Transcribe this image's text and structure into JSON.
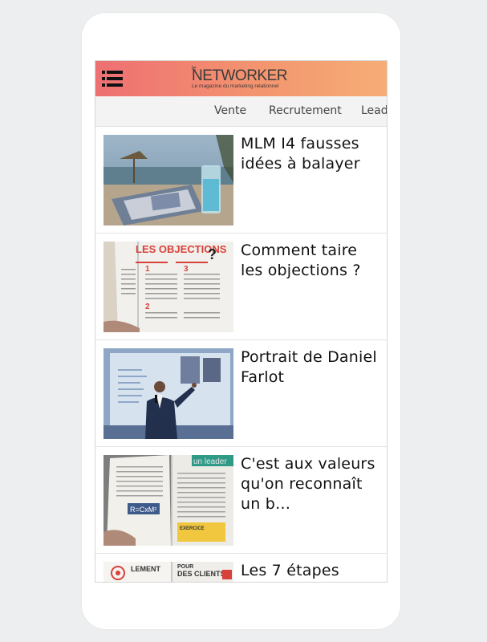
{
  "header": {
    "logo_small": "le",
    "logo_word": "NETWORKER",
    "logo_tagline": "Le magazine du marketing relationnel"
  },
  "categories": [
    "Vente",
    "Recrutement",
    "Lead"
  ],
  "articles": [
    {
      "title": "MLM I4 fausses idées à balayer",
      "image": "beach-magazines"
    },
    {
      "title": "Comment taire les objections ?",
      "image": "magazine-objections"
    },
    {
      "title": "Portrait de Daniel Farlot",
      "image": "speaker-presentation"
    },
    {
      "title": "C'est aux valeurs qu'on reconnaît un b…",
      "image": "magazine-leader"
    },
    {
      "title": "Les 7 étapes",
      "image": "magazine-clients"
    }
  ],
  "colors": {
    "header_gradient_start": "#ee6f72",
    "header_gradient_end": "#f6ad76",
    "nav_background": "#f3f3f3"
  },
  "icons": {
    "menu": "hamburger-menu-icon"
  }
}
